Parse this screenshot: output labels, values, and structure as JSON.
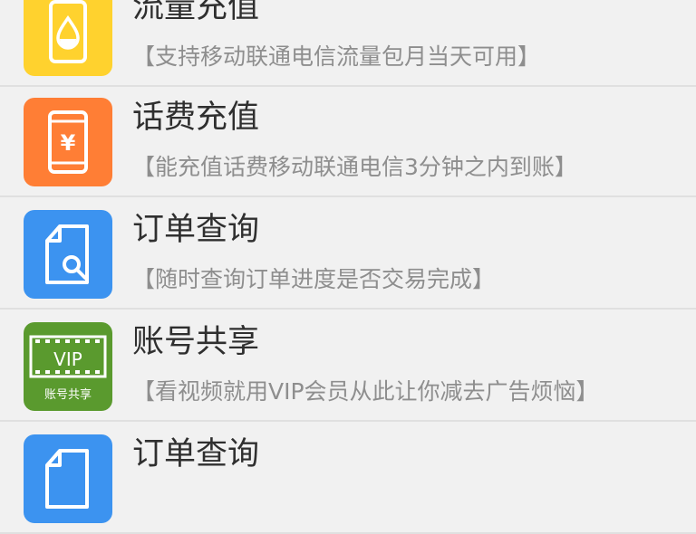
{
  "items": [
    {
      "title": "流量充值",
      "desc": "【支持移动联通电信流量包月当天可用】",
      "icon": "traffic-recharge-icon",
      "color": "#ffd22e"
    },
    {
      "title": "话费充值",
      "desc": "【能充值话费移动联通电信3分钟之内到账】",
      "icon": "phone-bill-recharge-icon",
      "color": "#ff7e35"
    },
    {
      "title": "订单查询",
      "desc": "【随时查询订单进度是否交易完成】",
      "icon": "order-search-icon",
      "color": "#3c93f0"
    },
    {
      "title": "账号共享",
      "desc": "【看视频就用VIP会员从此让你减去广告烦恼】",
      "icon": "vip-account-share-icon",
      "color": "#5a9a2e",
      "icon_text": "VIP",
      "icon_caption": "账号共享"
    },
    {
      "title": "订单查询",
      "desc": "",
      "icon": "order-search-icon",
      "color": "#3c93f0"
    }
  ]
}
